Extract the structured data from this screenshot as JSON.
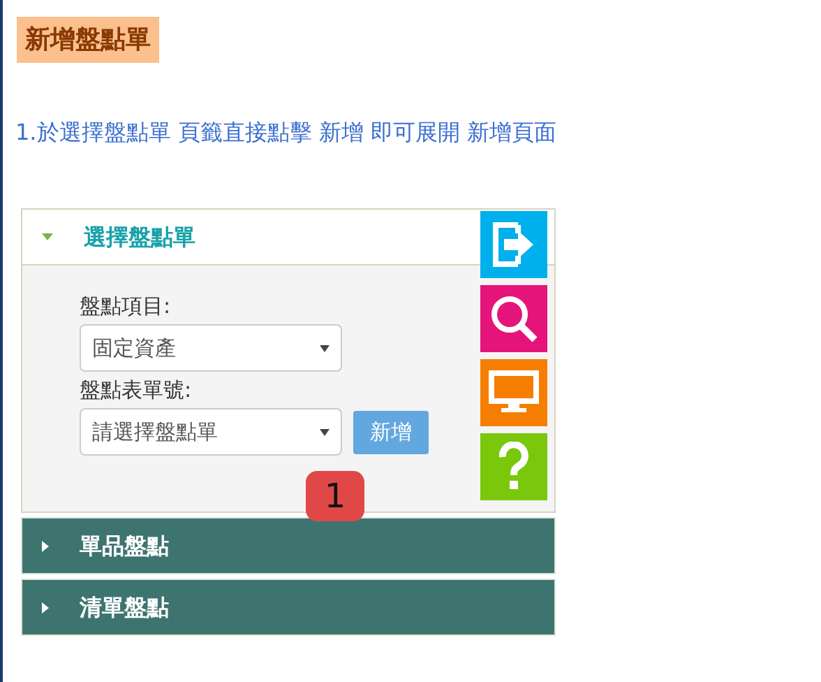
{
  "title": "新增盤點單",
  "instruction": "1.於選擇盤點單 頁籤直接點擊 新增 即可展開 新增頁面",
  "sections": [
    {
      "label": "選擇盤點單",
      "expanded": true,
      "fields": [
        {
          "label": "盤點項目:",
          "value": "固定資產"
        },
        {
          "label": "盤點表單號:",
          "value": "請選擇盤點單",
          "button": "新增"
        }
      ]
    },
    {
      "label": "單品盤點",
      "expanded": false
    },
    {
      "label": "清單盤點",
      "expanded": false
    }
  ],
  "badge": "1"
}
